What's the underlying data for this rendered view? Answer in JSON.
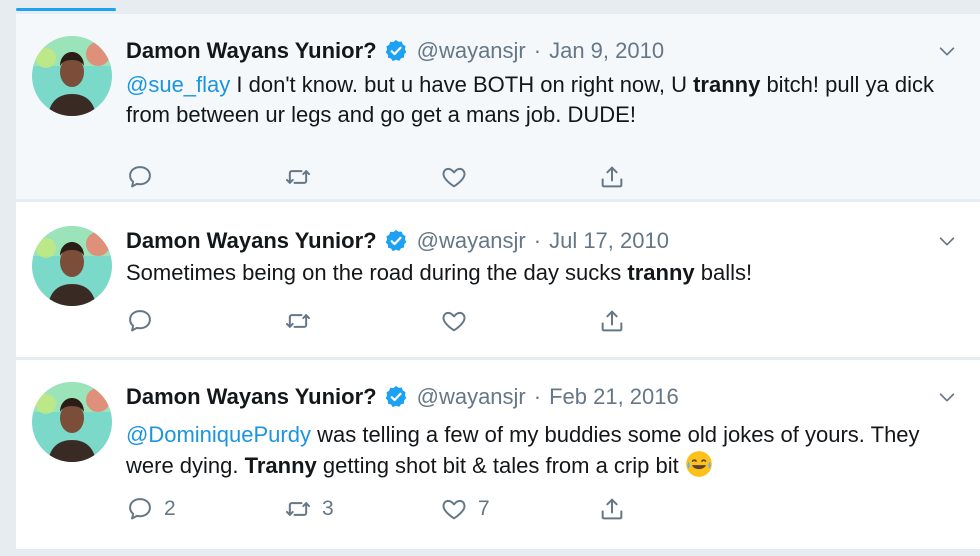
{
  "account": {
    "display_name": "Damon Wayans Yunior?",
    "handle": "@wayansjr",
    "separator": "·"
  },
  "tweets": [
    {
      "date": "Jan 9, 2010",
      "segments": [
        {
          "text": "@sue_flay",
          "style": "mention"
        },
        {
          "text": " I don't know. but u have BOTH on right now, U ",
          "style": "normal"
        },
        {
          "text": "tranny",
          "style": "bold"
        },
        {
          "text": " bitch! pull ya dick from between ur legs and go get a mans job. DUDE!",
          "style": "normal"
        }
      ],
      "counts": {
        "reply": "",
        "retweet": "",
        "like": ""
      }
    },
    {
      "date": "Jul 17, 2010",
      "segments": [
        {
          "text": "Sometimes being on the road during the day sucks ",
          "style": "normal"
        },
        {
          "text": "tranny",
          "style": "bold"
        },
        {
          "text": " balls!",
          "style": "normal"
        }
      ],
      "counts": {
        "reply": "",
        "retweet": "",
        "like": ""
      }
    },
    {
      "date": "Feb 21, 2016",
      "segments": [
        {
          "text": "@DominiquePurdy",
          "style": "mention"
        },
        {
          "text": " was telling a few of my buddies some old jokes of yours. They were dying. ",
          "style": "normal"
        },
        {
          "text": "Tranny",
          "style": "bold"
        },
        {
          "text": " getting shot bit & tales from a crip bit ",
          "style": "normal"
        }
      ],
      "emoji": "face-with-tears-of-joy",
      "counts": {
        "reply": "2",
        "retweet": "3",
        "like": "7"
      }
    }
  ],
  "icons": {
    "reply": "reply-icon",
    "retweet": "retweet-icon",
    "like": "like-icon",
    "share": "share-icon",
    "verified": "verified-badge-icon",
    "caret": "chevron-down-icon"
  },
  "colors": {
    "accent": "#1da1f2",
    "mention": "#1b95e0",
    "secondary_text": "#657786",
    "icon": "#657786"
  }
}
